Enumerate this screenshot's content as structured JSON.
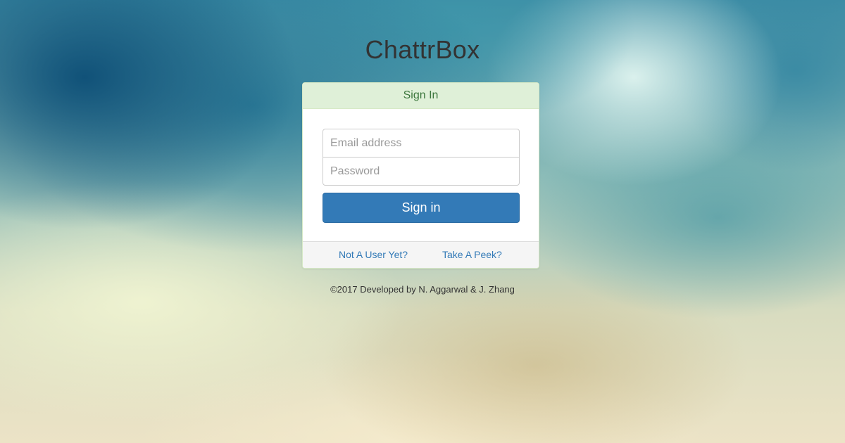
{
  "app": {
    "title": "ChattrBox"
  },
  "signin_panel": {
    "heading": "Sign In",
    "email": {
      "value": "",
      "placeholder": "Email address"
    },
    "password": {
      "value": "",
      "placeholder": "Password"
    },
    "submit_label": "Sign in",
    "footer_links": {
      "register": "Not A User Yet?",
      "peek": "Take A Peek?"
    }
  },
  "footer": {
    "copyright": "©2017 Developed by N. Aggarwal & J. Zhang"
  },
  "colors": {
    "primary": "#337ab7",
    "panel_heading_bg": "#dff0d8",
    "panel_heading_text": "#3c763d",
    "panel_footer_bg": "#f5f5f5"
  }
}
